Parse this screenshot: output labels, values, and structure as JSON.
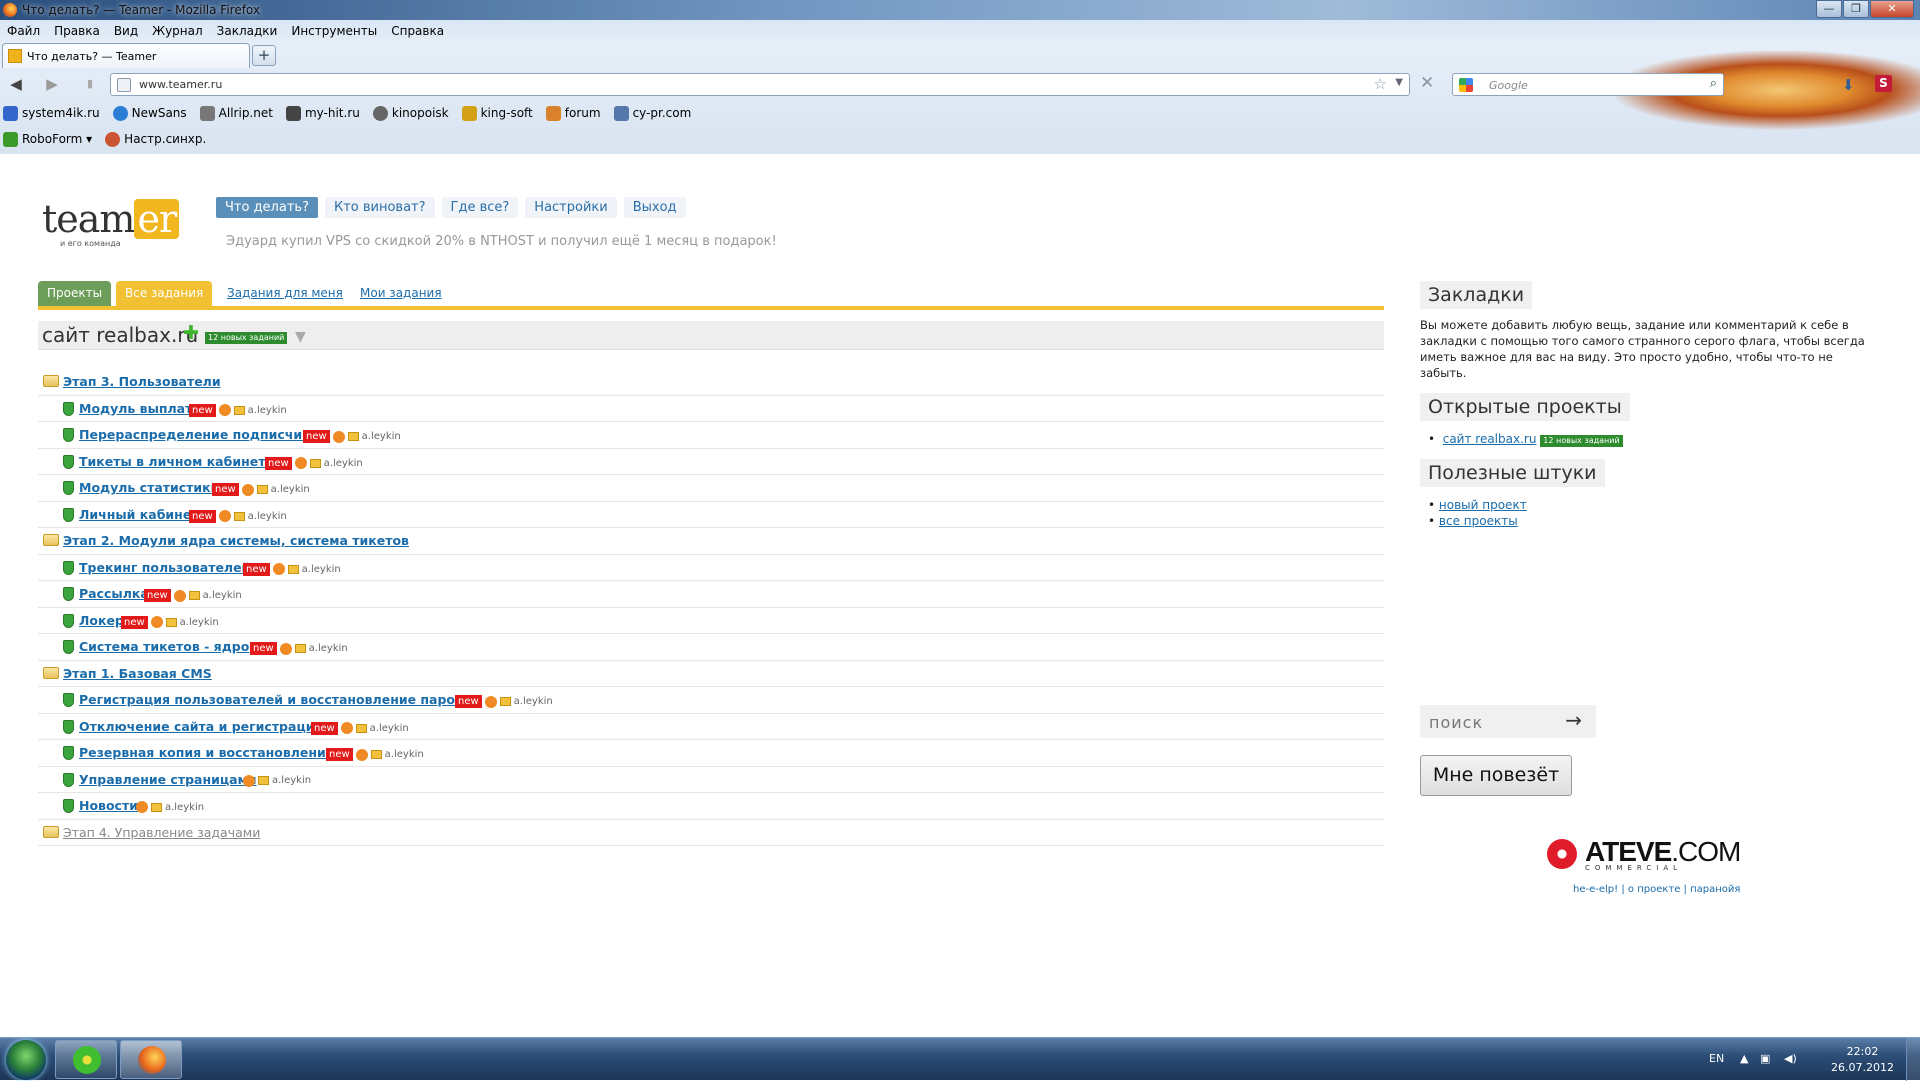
{
  "window": {
    "title": "Что делать? — Teamer - Mozilla Firefox"
  },
  "menu": [
    "Файл",
    "Правка",
    "Вид",
    "Журнал",
    "Закладки",
    "Инструменты",
    "Справка"
  ],
  "tab": {
    "label": "Что делать? — Teamer",
    "new_tab": "+"
  },
  "address": {
    "url": "www.teamer.ru",
    "search_placeholder": "Google"
  },
  "bookmarks": [
    {
      "label": "system4ik.ru",
      "icon": "system4ik-icon",
      "color": "#3366cc"
    },
    {
      "label": "NewSans",
      "icon": "newsans-icon",
      "color": "#2a7fd4"
    },
    {
      "label": "Allrip.net",
      "icon": "allrip-icon",
      "color": "#777777"
    },
    {
      "label": "my-hit.ru",
      "icon": "myhit-icon",
      "color": "#444444"
    },
    {
      "label": "kinopoisk",
      "icon": "kinopoisk-icon",
      "color": "#666666"
    },
    {
      "label": "king-soft",
      "icon": "crown-icon",
      "color": "#d4a017"
    },
    {
      "label": "forum",
      "icon": "forum-icon",
      "color": "#d9822b"
    },
    {
      "label": "cy-pr.com",
      "icon": "cypr-icon",
      "color": "#5577aa"
    }
  ],
  "bookmarks2": [
    {
      "label": "RoboForm",
      "icon": "roboform-icon",
      "color": "#3a9a2a"
    },
    {
      "label": "Настр.синхр.",
      "icon": "sync-icon",
      "color": "#cc5533"
    }
  ],
  "site": {
    "logo": {
      "main": "team",
      "accent": "er",
      "tagline": "и его команда"
    },
    "nav": [
      "Что делать?",
      "Кто виноват?",
      "Где все?",
      "Настройки",
      "Выход"
    ],
    "promo": {
      "pre": "Эдуард купил ",
      "link1": "VPS со скидкой 20%",
      "mid": " в ",
      "link2": "NTHOST",
      "post": " и получил ещё 1 месяц в подарок!"
    },
    "tabs": [
      "Проекты",
      "Все задания",
      "Задания для меня",
      "Мои задания"
    ],
    "project": {
      "name": "сайт realbax.ru",
      "badge": "12 новых заданий"
    },
    "stages": [
      {
        "title": "Этап 3. Пользователи",
        "tasks": [
          {
            "title": "Модуль выплаты",
            "new": true,
            "user": "a.leykin"
          },
          {
            "title": "Перераспределение подписчиков",
            "new": true,
            "user": "a.leykin"
          },
          {
            "title": "Тикеты в личном кабинете",
            "new": true,
            "user": "a.leykin"
          },
          {
            "title": "Модуль статистики",
            "new": true,
            "user": "a.leykin"
          },
          {
            "title": "Личный кабинет",
            "new": true,
            "user": "a.leykin"
          }
        ]
      },
      {
        "title": "Этап 2. Модули ядра системы, система тикетов",
        "tasks": [
          {
            "title": "Трекинг пользователей",
            "new": true,
            "user": "a.leykin"
          },
          {
            "title": "Рассылка",
            "new": true,
            "user": "a.leykin"
          },
          {
            "title": "Локер",
            "new": true,
            "user": "a.leykin"
          },
          {
            "title": "Система тикетов - ядро",
            "new": true,
            "user": "a.leykin"
          }
        ]
      },
      {
        "title": "Этап 1. Базовая CMS",
        "tasks": [
          {
            "title": "Регистрация пользователей и восстановление пароля",
            "new": true,
            "user": "a.leykin"
          },
          {
            "title": "Отключение сайта и регистрации",
            "new": true,
            "user": "a.leykin"
          },
          {
            "title": "Резервная копия и восстановление",
            "new": true,
            "user": "a.leykin"
          },
          {
            "title": "Управление страницами",
            "new": false,
            "user": "a.leykin"
          },
          {
            "title": "Новости",
            "new": false,
            "user": "a.leykin"
          }
        ]
      },
      {
        "title": "Этап 4. Управление задачами",
        "dim": true,
        "tasks": []
      }
    ],
    "new_label": "new",
    "sidebar": {
      "bookmarks_title": "Закладки",
      "bookmarks_text": "Вы можете добавить любую вещь, задание или комментарий к себе в закладки с помощью того самого странного серого флага, чтобы всегда иметь важное для вас на виду. Это просто удобно, чтобы что-то не забыть.",
      "open_projects_title": "Открытые проекты",
      "open_project": "сайт realbax.ru",
      "open_project_badge": "12 новых заданий",
      "useful_title": "Полезные штуки",
      "useful": [
        "новый проект",
        "все проекты"
      ],
      "search_label": "поиск",
      "search_arrow": "→",
      "lucky": "Мне повезёт",
      "ateve_main": "ATEVE",
      "ateve_dot": ".COM",
      "ateve_sub": "COMMERCIAL",
      "footer": [
        "he-e-elp!",
        "о проекте",
        "паранойя"
      ],
      "footer_sep": " | "
    }
  },
  "taskbar": {
    "lang": "EN",
    "time": "22:02",
    "date": "26.07.2012"
  }
}
